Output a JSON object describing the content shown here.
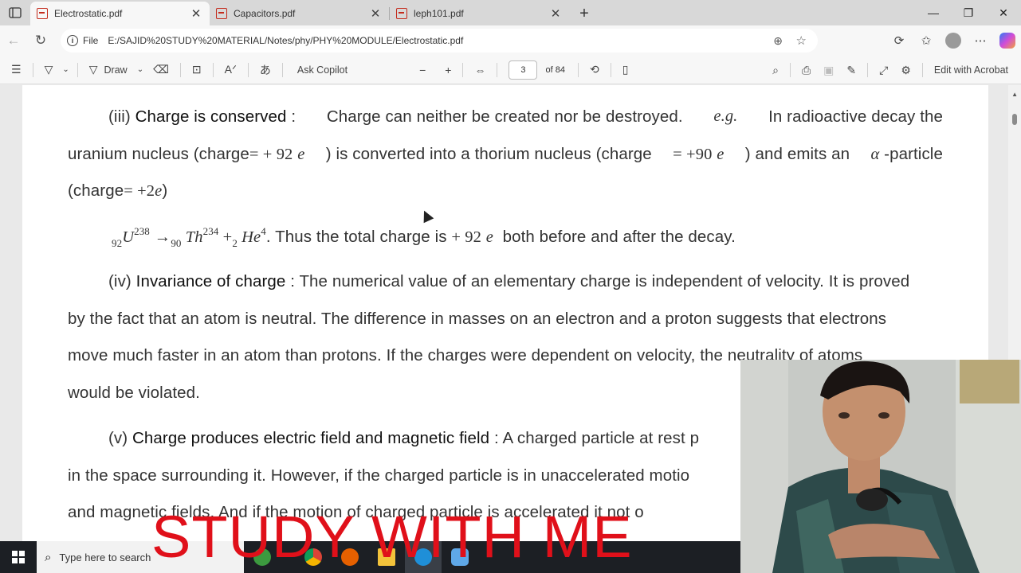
{
  "tabs": [
    {
      "title": "Electrostatic.pdf",
      "active": true
    },
    {
      "title": "Capacitors.pdf",
      "active": false
    },
    {
      "title": "leph101.pdf",
      "active": false
    }
  ],
  "address": {
    "file_label": "File",
    "url": "E:/SAJID%20STUDY%20MATERIAL/Notes/phy/PHY%20MODULE/Electrostatic.pdf"
  },
  "pdf_toolbar": {
    "draw_label": "Draw",
    "ask_copilot_label": "Ask Copilot",
    "page_current": "3",
    "page_total": "of 84",
    "edit_acrobat_label": "Edit with Acrobat"
  },
  "document": {
    "p1": {
      "num": "(iii)",
      "heading": "Charge is conserved",
      "sep": " : ",
      "body": "Charge can neither be created nor be destroyed.",
      "eg": "e.g.",
      "body2": "In radioactive decay the"
    },
    "p1_line2": {
      "a": "uranium nucleus (charge",
      "eq1": "= + 92",
      "e1": "e",
      "b": ") is converted into a thorium nucleus (charge",
      "eq2": "= +90",
      "e2": "e",
      "c": ") and emits an",
      "alpha": "α",
      "d": "-particle"
    },
    "p1_line3": {
      "a": "(charge",
      "eq": "= +2",
      "e": "e",
      "b": ")"
    },
    "equation": {
      "z1": "92",
      "el1": "U",
      "a1": "238",
      "arrow": "→",
      "z2": "90",
      "el2": " Th",
      "a2": "234",
      "plus": " +",
      "z3": "2",
      "el3": " He",
      "a3": "4",
      "tail": ". Thus the total charge is",
      "val": "+ 92",
      "e": "e",
      "tail2": "both before and after the decay."
    },
    "p2": {
      "num": "(iv)",
      "heading": "Invariance of charge",
      "rest": " : The numerical value of an elementary charge is independent of velocity. It is proved",
      "line2": "by the fact that an atom is neutral. The difference in masses on an electron and a proton suggests that electrons",
      "line3": "move much faster in an atom than protons. If the charges were dependent on velocity, the neutrality of atoms",
      "line4": "would be violated."
    },
    "p3": {
      "num": "(v)",
      "heading": "Charge produces electric field and magnetic field",
      "rest": " : A charged particle at rest p",
      "line2": "in the space surrounding it. However, if the charged particle is in unaccelerated motio",
      "line3": "and magnetic fields. And if the motion of charged particle is accelerated it not o"
    }
  },
  "taskbar": {
    "search_placeholder": "Type here to search"
  },
  "overlay": {
    "title": "STUDY WITH ME"
  }
}
